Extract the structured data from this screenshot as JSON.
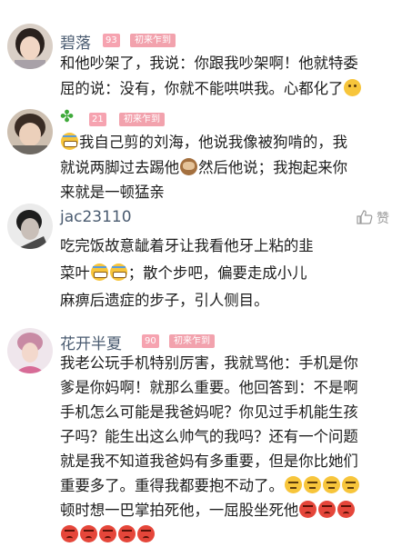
{
  "comments": [
    {
      "name": "碧落",
      "level": "93",
      "badge": "初来乍到",
      "lines": [
        "和他吵架了，我说：你跟我吵架啊！他就特委",
        "屈的说：没有，你就不能哄哄我。心都化了"
      ]
    },
    {
      "name": "",
      "level": "21",
      "badge": "初来乍到",
      "lines": [
        "我自己剪的刘海，他说我像被狗啃的，我",
        "就说两脚过去踢他",
        "然后他说；我抱起来你",
        "来就是一顿猛亲"
      ]
    },
    {
      "name": "jac23110",
      "like_label": "赞",
      "lines": [
        "吃完饭故意龇着牙让我看他牙上粘的韭",
        "菜叶",
        "；散个步吧，偏要走成小儿",
        "麻痹后遗症的步子，引人侧目。"
      ]
    },
    {
      "name": "花开半夏",
      "level": "90",
      "badge": "初来乍到",
      "lines": [
        "我老公玩手机特别厉害，我就骂他：手机是你",
        "爹是你妈啊！就那么重要。他回答到：不是啊",
        "手机怎么可能是我爸妈呢？你见过手机能生孩",
        "子吗？能生出这么帅气的我吗？还有一个问题",
        "就是我不知道我爸妈有多重要，但是你比她们",
        "重要多了。重得我都要抱不动了。",
        "顿时想一巴掌拍死他，一屈股坐死他"
      ]
    }
  ]
}
